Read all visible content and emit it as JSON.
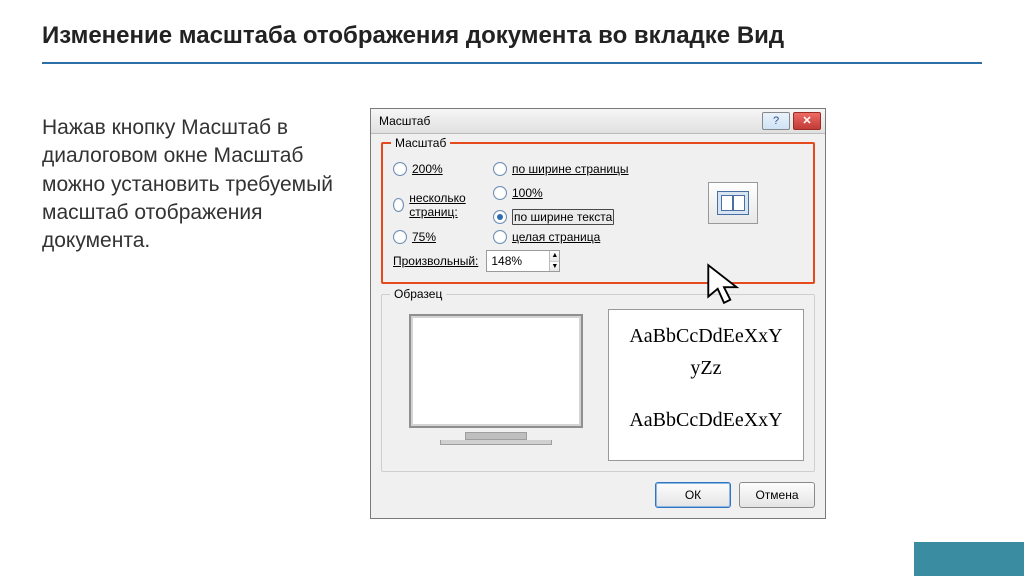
{
  "slide": {
    "title": "Изменение масштаба отображения документа во вкладке Вид",
    "body": "Нажав кнопку Масштаб в диалоговом окне Масштаб можно установить требуемый масштаб отображения документа."
  },
  "dialog": {
    "title": "Масштаб",
    "group_zoom": {
      "legend": "Масштаб",
      "options": {
        "p200": "200%",
        "p100": "100%",
        "p75": "75%",
        "page_width": "по ширине страницы",
        "text_width": "по ширине текста",
        "whole_page": "целая страница",
        "many_pages": "несколько страниц:"
      },
      "selected": "text_width",
      "custom_label": "Произвольный:",
      "custom_value": "148%"
    },
    "group_preview": {
      "legend": "Образец",
      "sample_line1": "AaBbCcDdEeXxY",
      "sample_line2": "yZz",
      "sample_line3": "AaBbCcDdEeXxY"
    },
    "buttons": {
      "ok": "ОК",
      "cancel": "Отмена"
    }
  }
}
